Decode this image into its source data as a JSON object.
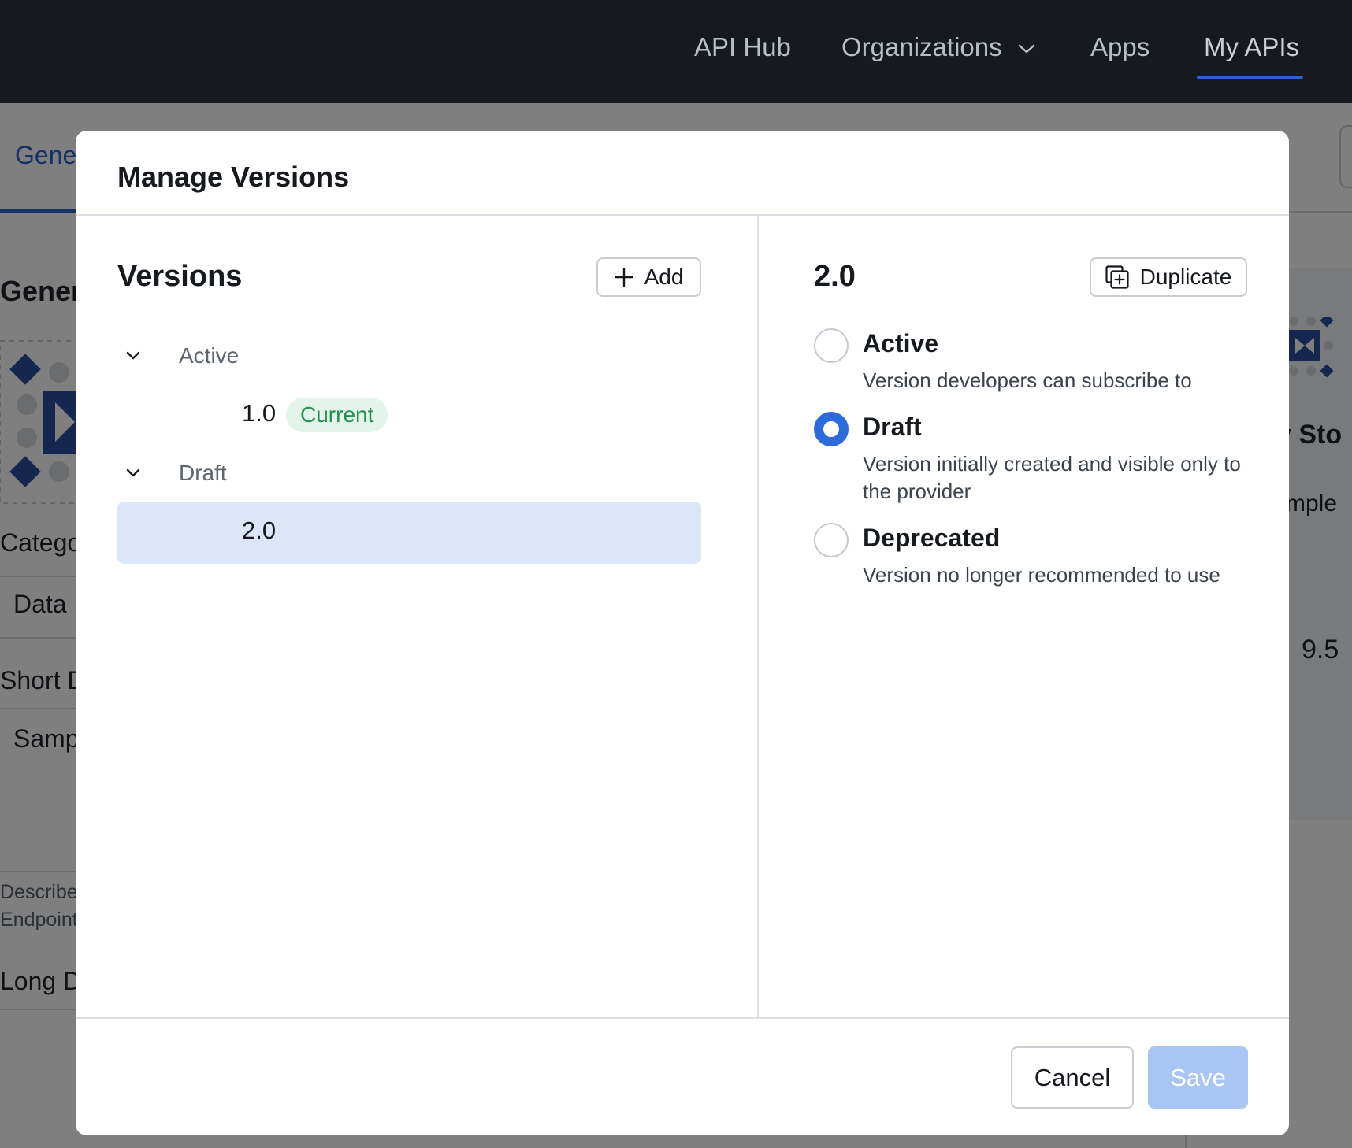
{
  "nav": {
    "items": [
      "API Hub",
      "Organizations",
      "Apps",
      "My APIs"
    ],
    "active_index": 3
  },
  "background": {
    "tab_fragment": "Gene",
    "section_fragment": "Genera",
    "category_label": "Catego",
    "category_value": "Data",
    "short_desc_label": "Short D",
    "short_desc_value": "Samp",
    "describe_line1": "Describe",
    "describe_line2": "Endpoint",
    "long_desc_label": "Long De",
    "right_title_fragment": "y Sto",
    "right_sub_fragment": "mple",
    "right_number": "9.5"
  },
  "modal": {
    "title": "Manage Versions",
    "versions_panel": {
      "title": "Versions",
      "add_label": "Add",
      "groups": [
        {
          "label": "Active",
          "versions": [
            {
              "label": "1.0",
              "badge": "Current"
            }
          ]
        },
        {
          "label": "Draft",
          "versions": [
            {
              "label": "2.0",
              "badge": ""
            }
          ]
        }
      ],
      "selected_version": "2.0"
    },
    "detail_panel": {
      "title": "2.0",
      "duplicate_label": "Duplicate",
      "options": [
        {
          "label": "Active",
          "description": "Version developers can subscribe to",
          "checked": false
        },
        {
          "label": "Draft",
          "description": "Version initially created and visible only to the provider",
          "checked": true
        },
        {
          "label": "Deprecated",
          "description": "Version no longer recommended to use",
          "checked": false
        }
      ]
    },
    "footer": {
      "cancel_label": "Cancel",
      "save_label": "Save"
    }
  },
  "colors": {
    "nav_bg": "#16191d",
    "accent": "#2c6bdc",
    "selected_row": "#dde6f8",
    "badge_bg": "#e3f4ea",
    "badge_text": "#26904f",
    "save_disabled": "#a9c5f4"
  },
  "icons": {
    "nav_dropdown": "chevron-down-icon",
    "group_toggle": "chevron-down-icon",
    "add": "plus-icon",
    "duplicate": "duplicate-icon"
  }
}
